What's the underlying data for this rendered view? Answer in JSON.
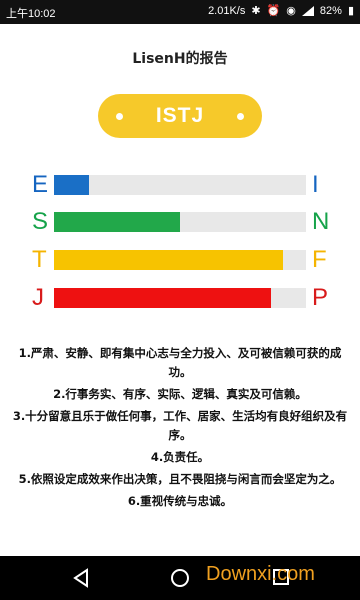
{
  "status_bar": {
    "time": "上午10:02",
    "speed": "2.01K/s",
    "battery": "82%"
  },
  "report": {
    "title": "LisenH的报告",
    "type": "ISTJ",
    "accent": "#f6c92a"
  },
  "dimensions": [
    {
      "left": "E",
      "right": "I",
      "left_color": "#1565c0",
      "right_color": "#1565c0",
      "fill_color": "#1a6fc6",
      "level": 0.14
    },
    {
      "left": "S",
      "right": "N",
      "left_color": "#16a34a",
      "right_color": "#16a34a",
      "fill_color": "#22a84a",
      "level": 0.5
    },
    {
      "left": "T",
      "right": "F",
      "left_color": "#f5b400",
      "right_color": "#f5b400",
      "fill_color": "#f7c300",
      "level": 0.91
    },
    {
      "left": "J",
      "right": "P",
      "left_color": "#d81b1b",
      "right_color": "#d81b1b",
      "fill_color": "#ee1111",
      "level": 0.86
    }
  ],
  "descriptions": [
    "1.严肃、安静、即有集中心志与全力投入、及可被信赖可获的成功。",
    "2.行事务实、有序、实际、逻辑、真实及可信赖。",
    "3.十分留意且乐于做任何事，工作、居家、生活均有良好组织及有序。",
    "4.负责任。",
    "5.依照设定成效来作出决策，且不畏阻挠与闲言而会坚定为之。",
    "6.重视传统与忠诚。"
  ],
  "nav": {
    "back_icon": "back-triangle-icon",
    "home_icon": "home-circle-icon",
    "recent_icon": "recent-square-icon",
    "watermark": "Downxi.com"
  }
}
